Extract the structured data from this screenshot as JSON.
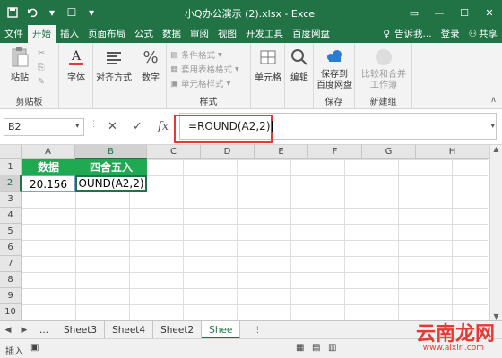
{
  "titlebar": {
    "title": "小Q办公演示 (2).xlsx - Excel",
    "save_icon": "save-icon",
    "undo_icon": "undo-icon"
  },
  "menu": {
    "tabs": [
      "文件",
      "开始",
      "插入",
      "页面布局",
      "公式",
      "数据",
      "审阅",
      "视图",
      "开发工具",
      "百度网盘"
    ],
    "active": "开始",
    "tell": "告诉我...",
    "login": "登录",
    "share": "共享"
  },
  "ribbon": {
    "clipboard": {
      "paste": "粘贴",
      "label": "剪贴板"
    },
    "font": {
      "label": "字体"
    },
    "align": {
      "label": "对齐方式"
    },
    "number": {
      "label": "数字"
    },
    "styles": {
      "cond": "条件格式",
      "table": "套用表格格式",
      "cell": "单元格样式",
      "label": "样式"
    },
    "cells": {
      "label": "单元格"
    },
    "edit": {
      "label": "编辑"
    },
    "save": {
      "line1": "保存到",
      "line2": "百度网盘",
      "label": "保存"
    },
    "newgroup": {
      "line1": "比较和合并",
      "line2": "工作簿",
      "label": "新建组"
    }
  },
  "formula": {
    "namebox": "B2",
    "cancel": "✕",
    "enter": "✓",
    "fx": "fx",
    "value": "=ROUND(A2,2)"
  },
  "grid": {
    "columns": [
      "A",
      "B",
      "C",
      "D",
      "E",
      "F",
      "G",
      "H"
    ],
    "rows": [
      "1",
      "2",
      "3",
      "4",
      "5",
      "6",
      "7",
      "8",
      "9",
      "10"
    ],
    "A1": "数据",
    "B1": "四舍五入",
    "A2": "20.156",
    "B2": "OUND(A2,2)"
  },
  "sheets": {
    "ellipsis": "...",
    "tabs": [
      "Sheet3",
      "Sheet4",
      "Sheet2",
      "Shee"
    ],
    "active": "Shee"
  },
  "status": {
    "mode": "插入"
  },
  "watermark": {
    "brand": "云南龙网",
    "url": "www.aixiri.com"
  }
}
